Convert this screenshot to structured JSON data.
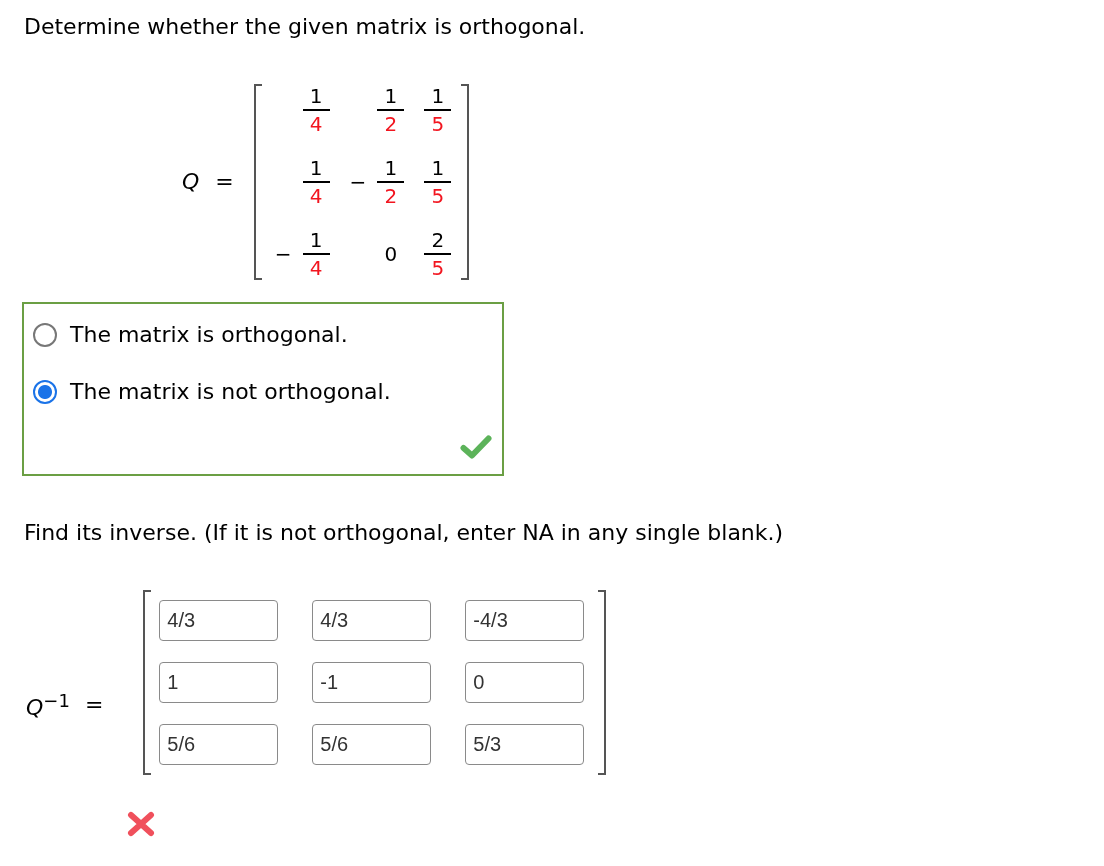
{
  "question": {
    "text": "Determine whether the given matrix is orthogonal."
  },
  "matrix": {
    "symbol": "Q",
    "equals": "=",
    "rows": [
      [
        {
          "kind": "fraction",
          "numerator": "1",
          "denominator": "4",
          "denominator_marked": true
        },
        {
          "kind": "fraction",
          "numerator": "1",
          "denominator": "2",
          "denominator_marked": true
        },
        {
          "kind": "fraction",
          "numerator": "1",
          "denominator": "5",
          "denominator_marked": true
        }
      ],
      [
        {
          "kind": "fraction",
          "numerator": "1",
          "denominator": "4",
          "denominator_marked": true
        },
        {
          "kind": "fraction",
          "sign": "−",
          "numerator": "1",
          "denominator": "2",
          "denominator_marked": true
        },
        {
          "kind": "fraction",
          "numerator": "1",
          "denominator": "5",
          "denominator_marked": true
        }
      ],
      [
        {
          "kind": "fraction",
          "sign": "−",
          "numerator": "1",
          "denominator": "4",
          "denominator_marked": true
        },
        {
          "kind": "number",
          "value": "0"
        },
        {
          "kind": "fraction",
          "numerator": "2",
          "denominator": "5",
          "denominator_marked": true
        }
      ]
    ]
  },
  "choices": {
    "correct": true,
    "options": [
      {
        "label": "The matrix is orthogonal.",
        "selected": false
      },
      {
        "label": "The matrix is not orthogonal.",
        "selected": true
      }
    ]
  },
  "instruction": {
    "text": "Find its inverse. (If it is not orthogonal, enter NA in any single blank.)"
  },
  "inverse": {
    "symbol": "*Q*$^{−1}$",
    "equals": "=",
    "rows": [
      [
        "4/3",
        "4/3",
        "-4/3"
      ],
      [
        "1",
        "-1",
        "0"
      ],
      [
        "5/6",
        "5/6",
        "5/3"
      ]
    ],
    "correct": false
  }
}
